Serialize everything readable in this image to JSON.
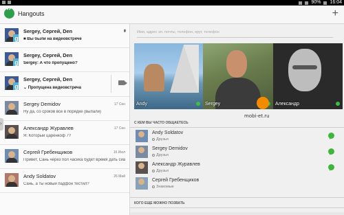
{
  "status_bar": {
    "time": "16:04",
    "battery": "90%"
  },
  "app": {
    "title": "Hangouts",
    "add_icon": "plus-icon"
  },
  "conversations": [
    {
      "name": "Sergey, Сергей, Den",
      "preview": "■ Вы были на видеовстрече",
      "date": "",
      "bold": true,
      "trailing": "signal"
    },
    {
      "name": "Sergey, Сергей, Den",
      "preview": "Sergey: А что пропущено?",
      "date": "",
      "bold": true,
      "trailing": "none"
    },
    {
      "name": "Sergey, Сергей, Den",
      "preview": "⌄ Пропущена видеовстреча",
      "date": "",
      "bold": true,
      "trailing": "videocam"
    },
    {
      "name": "Sergey Demidov",
      "preview": "Ну да, со сроков все в порядке (выпали)",
      "date": "17 Сен",
      "bold": false,
      "trailing": "none"
    },
    {
      "name": "Александр Журавлев",
      "preview": "Я: Который царенкоф 7?",
      "date": "17 Сен",
      "bold": false,
      "trailing": "none"
    },
    {
      "name": "Сергей Гребенщиков",
      "preview": "Привет, Сань через пол часика будет время дать сиара...",
      "date": "16 Июл",
      "bold": false,
      "trailing": "none"
    },
    {
      "name": "Andy Soldatov",
      "preview": "Сань, а ты новый падфон тестил?",
      "date": "26 Май",
      "bold": false,
      "trailing": "none"
    }
  ],
  "search": {
    "placeholder": "Имя, адрес эл. почты, телефон, круг, телефон"
  },
  "featured": [
    {
      "name": "Andy",
      "online": true
    },
    {
      "name": "Sergey",
      "online": true
    },
    {
      "name": "Александр",
      "online": true
    }
  ],
  "frequent_section": {
    "title": "С КЕМ ВЫ ЧАСТО ОБЩАЕТЕСЬ",
    "contacts": [
      {
        "name": "Andy Soldatov",
        "relation": "Друзья",
        "hangout": true
      },
      {
        "name": "Sergey Demidov",
        "relation": "Друзья",
        "hangout": true
      },
      {
        "name": "Александр Журавлев",
        "relation": "Друзья",
        "hangout": true
      },
      {
        "name": "Сергей Гребенщиков",
        "relation": "Знакомые",
        "hangout": false
      }
    ]
  },
  "invite_section": {
    "title": "КОГО ЕЩЕ МОЖНО ПОЗВАТЬ"
  },
  "watermark": {
    "text": "mobi-et.ru"
  },
  "colors": {
    "accent_green": "#3fbd45",
    "logo_green": "#2e9e4a"
  }
}
